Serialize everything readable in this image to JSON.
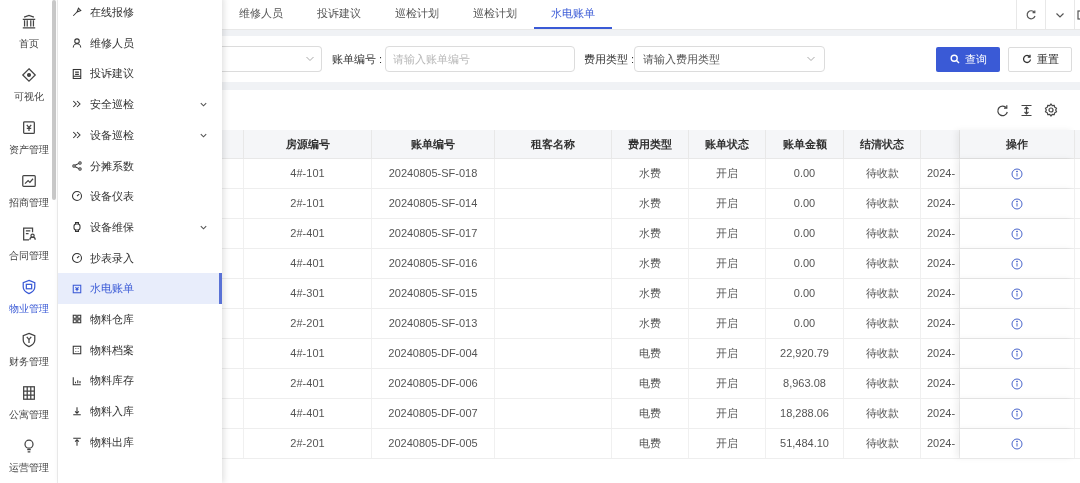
{
  "rail": {
    "items": [
      {
        "label": "首页",
        "selected": false
      },
      {
        "label": "可视化",
        "selected": false
      },
      {
        "label": "资产管理",
        "selected": false
      },
      {
        "label": "招商管理",
        "selected": false
      },
      {
        "label": "合同管理",
        "selected": false
      },
      {
        "label": "物业管理",
        "selected": true
      },
      {
        "label": "财务管理",
        "selected": false
      },
      {
        "label": "公寓管理",
        "selected": false
      },
      {
        "label": "运营管理",
        "selected": false
      }
    ]
  },
  "submenu": {
    "items": [
      {
        "label": "在线报修",
        "expandable": false,
        "selected": false
      },
      {
        "label": "维修人员",
        "expandable": false,
        "selected": false
      },
      {
        "label": "投诉建议",
        "expandable": false,
        "selected": false
      },
      {
        "label": "安全巡检",
        "expandable": true,
        "selected": false
      },
      {
        "label": "设备巡检",
        "expandable": true,
        "selected": false
      },
      {
        "label": "分摊系数",
        "expandable": false,
        "selected": false
      },
      {
        "label": "设备仪表",
        "expandable": false,
        "selected": false
      },
      {
        "label": "设备维保",
        "expandable": true,
        "selected": false
      },
      {
        "label": "抄表录入",
        "expandable": false,
        "selected": false
      },
      {
        "label": "水电账单",
        "expandable": false,
        "selected": true
      },
      {
        "label": "物料仓库",
        "expandable": false,
        "selected": false
      },
      {
        "label": "物料档案",
        "expandable": false,
        "selected": false
      },
      {
        "label": "物料库存",
        "expandable": false,
        "selected": false
      },
      {
        "label": "物料入库",
        "expandable": false,
        "selected": false
      },
      {
        "label": "物料出库",
        "expandable": false,
        "selected": false
      }
    ]
  },
  "tabs": [
    {
      "label": "维修人员",
      "selected": false
    },
    {
      "label": "投诉建议",
      "selected": false
    },
    {
      "label": "巡检计划",
      "selected": false
    },
    {
      "label": "巡检计划",
      "selected": false
    },
    {
      "label": "水电账单",
      "selected": true
    }
  ],
  "filters": {
    "bill_no": {
      "label": "账单编号 :",
      "placeholder": "请输入账单编号"
    },
    "fee_type": {
      "label": "费用类型 :",
      "placeholder": "请输入费用类型"
    },
    "buttons": [
      "查询",
      "重置"
    ]
  },
  "table": {
    "columns": [
      "房源编号",
      "账单编号",
      "租客名称",
      "费用类型",
      "账单状态",
      "账单金额",
      "结清状态",
      "操作"
    ],
    "rows": [
      {
        "room": "4#-101",
        "bill_no": "20240805-SF-018",
        "fee_type": "水费",
        "bill_status": "开启",
        "amount": "0.00",
        "settle_status": "待收款",
        "column_9": "2024-"
      },
      {
        "room": "2#-101",
        "bill_no": "20240805-SF-014",
        "fee_type": "水费",
        "bill_status": "开启",
        "amount": "0.00",
        "settle_status": "待收款",
        "column_9": "2024-"
      },
      {
        "room": "2#-401",
        "bill_no": "20240805-SF-017",
        "fee_type": "水费",
        "bill_status": "开启",
        "amount": "0.00",
        "settle_status": "待收款",
        "column_9": "2024-"
      },
      {
        "room": "4#-401",
        "bill_no": "20240805-SF-016",
        "fee_type": "水费",
        "bill_status": "开启",
        "amount": "0.00",
        "settle_status": "待收款",
        "column_9": "2024-"
      },
      {
        "room": "4#-301",
        "bill_no": "20240805-SF-015",
        "fee_type": "水费",
        "bill_status": "开启",
        "amount": "0.00",
        "settle_status": "待收款",
        "column_9": "2024-"
      },
      {
        "room": "2#-201",
        "bill_no": "20240805-SF-013",
        "fee_type": "水费",
        "bill_status": "开启",
        "amount": "0.00",
        "settle_status": "待收款",
        "column_9": "2024-"
      },
      {
        "room": "4#-101",
        "bill_no": "20240805-DF-004",
        "fee_type": "电费",
        "bill_status": "开启",
        "amount": "22,920.79",
        "settle_status": "待收款",
        "column_9": "2024-"
      },
      {
        "room": "2#-401",
        "bill_no": "20240805-DF-006",
        "fee_type": "电费",
        "bill_status": "开启",
        "amount": "8,963.08",
        "settle_status": "待收款",
        "column_9": "2024-"
      },
      {
        "room": "4#-401",
        "bill_no": "20240805-DF-007",
        "fee_type": "电费",
        "bill_status": "开启",
        "amount": "18,288.06",
        "settle_status": "待收款",
        "column_9": "2024-"
      },
      {
        "room": "2#-201",
        "bill_no": "20240805-DF-005",
        "fee_type": "电费",
        "bill_status": "开启",
        "amount": "51,484.10",
        "settle_status": "待收款",
        "column_9": "2024-"
      }
    ]
  }
}
